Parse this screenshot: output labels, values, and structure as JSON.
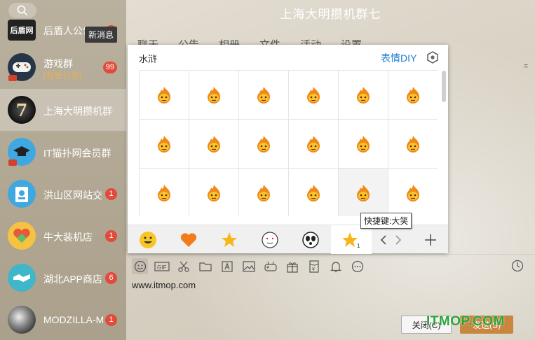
{
  "window": {
    "title": "上海大明攒机群七"
  },
  "tooltip_new_message": "新消息",
  "contacts": [
    {
      "name": "后盾人公告",
      "badge": "4",
      "avatar_text": "后盾网"
    },
    {
      "name": "游戏群",
      "sub": "[有新公告]",
      "badge": "99"
    },
    {
      "name": "上海大明攒机群七",
      "avatar_text": "7"
    },
    {
      "name": "IT猫扑网会员群"
    },
    {
      "name": "洪山区网站交流",
      "badge": "1"
    },
    {
      "name": "牛大装机店",
      "badge": "1"
    },
    {
      "name": "湖北APP商店",
      "badge": "6"
    },
    {
      "name": "MODZILLA-MOD",
      "badge": "1"
    }
  ],
  "tabs": [
    "聊天",
    "公告",
    "相册",
    "文件",
    "活动",
    "设置 ⌄"
  ],
  "emoji_panel": {
    "title": "水浒",
    "diy_label": "表情DIY",
    "shortcut_tooltip": "快捷键:大笑",
    "emojis": [
      "fire-blush",
      "fire-smile",
      "fire-grin",
      "fire-surprised",
      "fire-wink",
      "fire-happy",
      "fire-smirk",
      "fire-sleepy",
      "fire-teeth",
      "fire-angry",
      "fire-cry",
      "fire-shy",
      "fire-laugh",
      "fire-bowl",
      "fire-scared",
      "fire-shout",
      "fire-laugh-big",
      "fire-knife"
    ]
  },
  "categories": [
    "smiley-icon",
    "heart-icon",
    "star-icon",
    "face-sketch-icon",
    "panda-icon",
    "star-selected-icon",
    "arrows-icon",
    "plus-icon"
  ],
  "input": {
    "text": "www.itmop.com"
  },
  "buttons": {
    "close": "关闭(C)",
    "send": "发送(S)"
  },
  "watermark": "ITMOP.COM",
  "colors": {
    "accent_blue": "#1f7fd1",
    "badge_red": "#e24b3b",
    "send_orange": "#c8863f",
    "watermark_green": "#2fa33b"
  }
}
